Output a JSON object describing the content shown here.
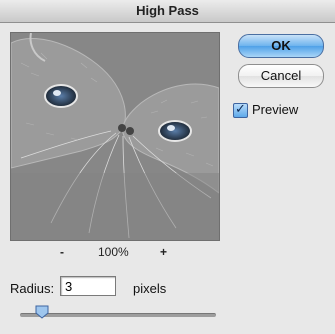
{
  "dialog": {
    "title": "High Pass"
  },
  "buttons": {
    "ok_label": "OK",
    "cancel_label": "Cancel"
  },
  "preview": {
    "label": "Preview",
    "checked": true,
    "check_glyph": "✓"
  },
  "zoom": {
    "minus_label": "-",
    "value": "100%",
    "plus_label": "+"
  },
  "radius": {
    "label": "Radius:",
    "value": "3",
    "unit": "pixels"
  },
  "slider": {
    "level_fraction": 0.11
  },
  "colors": {
    "accent": "#4fa1e8",
    "preview_gray": "#8c8c8c"
  },
  "icons": {
    "thumb": "slider-thumb-icon",
    "checkbox": "checkmark-icon"
  }
}
